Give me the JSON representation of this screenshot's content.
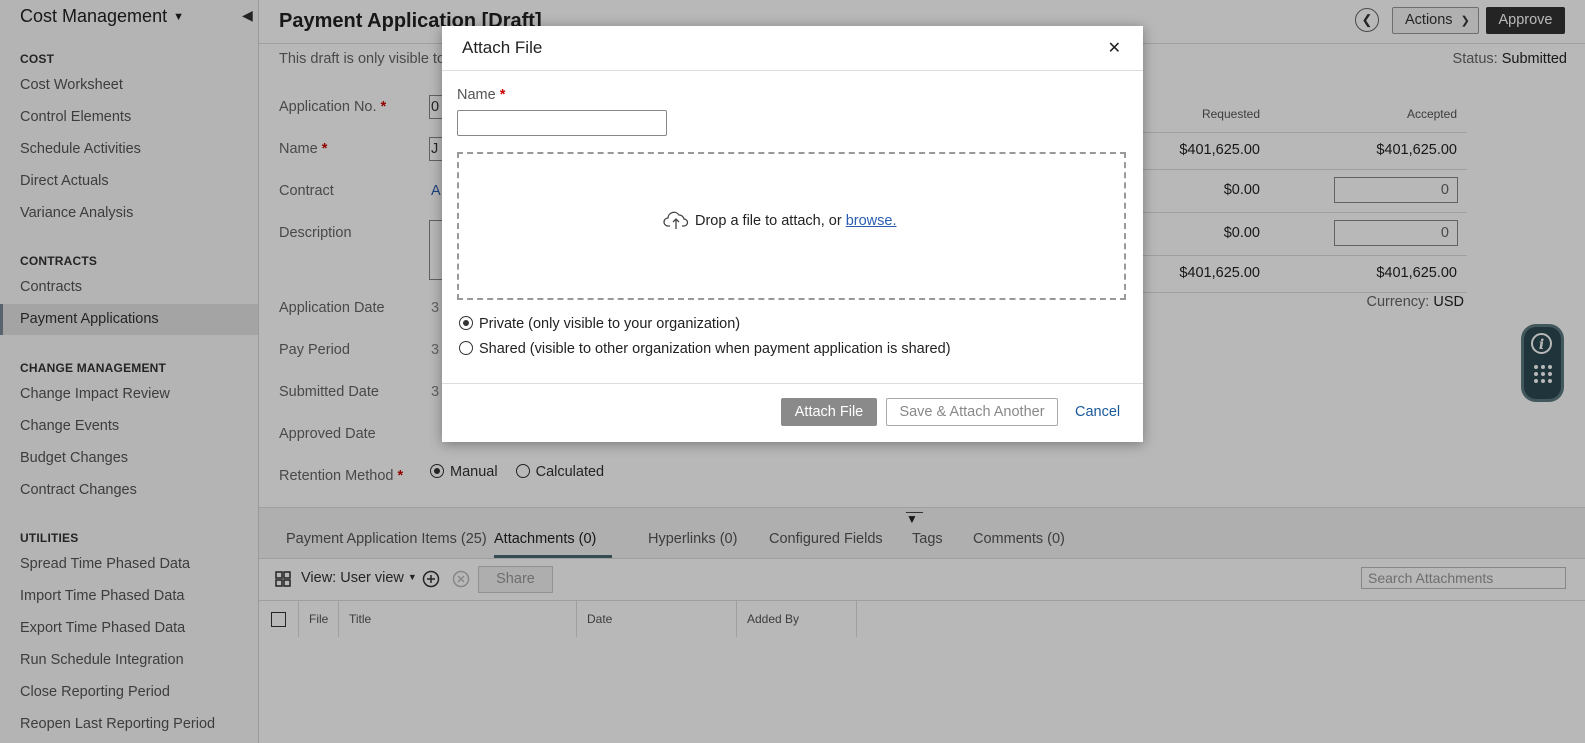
{
  "sidebar": {
    "header": "Cost Management",
    "sections": [
      {
        "title": "COST",
        "items": [
          "Cost Worksheet",
          "Control Elements",
          "Schedule Activities",
          "Direct Actuals",
          "Variance Analysis"
        ]
      },
      {
        "title": "CONTRACTS",
        "items": [
          "Contracts",
          "Payment Applications"
        ]
      },
      {
        "title": "CHANGE MANAGEMENT",
        "items": [
          "Change Impact Review",
          "Change Events",
          "Budget Changes",
          "Contract Changes"
        ]
      },
      {
        "title": "UTILITIES",
        "items": [
          "Spread Time Phased Data",
          "Import Time Phased Data",
          "Export Time Phased Data",
          "Run Schedule Integration",
          "Close Reporting Period",
          "Reopen Last Reporting Period"
        ]
      }
    ],
    "active_item": "Payment Applications"
  },
  "header": {
    "title": "Payment Application [Draft]",
    "back_icon": "chevron-left-icon",
    "actions_label": "Actions",
    "approve_label": "Approve"
  },
  "form": {
    "draft_note": "This draft is only visible to",
    "status_label": "Status:",
    "status_value": "Submitted",
    "application_no_label": "Application No.",
    "application_no_fragment": "0",
    "name_label": "Name",
    "name_fragment": "J",
    "contract_label": "Contract",
    "contract_fragment": "A",
    "description_label": "Description",
    "application_date_label": "Application Date",
    "application_date_fragment": "3",
    "pay_period_label": "Pay Period",
    "pay_period_fragment": "3",
    "submitted_date_label": "Submitted Date",
    "submitted_date_fragment": "3",
    "approved_date_label": "Approved Date",
    "retention_method_label": "Retention Method",
    "retention_options": [
      "Manual",
      "Calculated"
    ],
    "retention_selected": "Manual",
    "required_marker": "*"
  },
  "totals": {
    "headers": [
      "Requested",
      "Accepted"
    ],
    "rows": [
      {
        "requested": "$401,625.00",
        "accepted": "$401,625.00"
      },
      {
        "requested": "$0.00",
        "accepted_input": "0"
      },
      {
        "requested": "$0.00",
        "accepted_input": "0"
      },
      {
        "requested": "$401,625.00",
        "accepted": "$401,625.00"
      }
    ],
    "currency_label": "Currency:",
    "currency_value": "USD"
  },
  "tabs": [
    "Payment Application Items (25)",
    "Attachments (0)",
    "Hyperlinks (0)",
    "Configured Fields",
    "Tags",
    "Comments (0)"
  ],
  "active_tab": "Attachments (0)",
  "attachments_toolbar": {
    "view_label": "View: User view",
    "share_label": "Share",
    "search_placeholder": "Search Attachments"
  },
  "attachments_table": {
    "columns": [
      "File",
      "Title",
      "Date",
      "Added By"
    ]
  },
  "dialog": {
    "title": "Attach File",
    "name_label": "Name",
    "drop_text": "Drop a file to attach, or",
    "browse_link": "browse.",
    "visibility_options": [
      "Private (only visible to your organization)",
      "Shared (visible to other organization when payment application is shared)"
    ],
    "visibility_selected": 0,
    "attach_label": "Attach File",
    "save_attach_label": "Save & Attach Another",
    "cancel_label": "Cancel"
  },
  "colors": {
    "approve_bg": "#333333",
    "active_tab_underline": "#4a6a72",
    "help_widget_bg": "#2d4a52",
    "link": "#2a5db0"
  }
}
